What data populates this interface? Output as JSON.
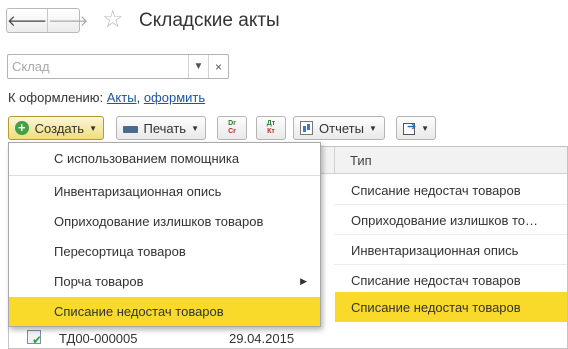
{
  "header": {
    "back_icon": "arrow-left-icon",
    "forward_icon": "arrow-right-icon",
    "back_glyph": "🡐",
    "forward_glyph": "🡒",
    "favorite_icon": "star-icon",
    "title": "Складские акты"
  },
  "filter": {
    "warehouse_placeholder": "Склад",
    "warehouse_value": ""
  },
  "info_line": {
    "prefix": "К оформлению:",
    "link_acts": "Акты",
    "separator": ",",
    "link_process": "оформить"
  },
  "toolbar": {
    "create_label": "Создать",
    "print_label": "Печать",
    "drcr_label_top": "Dr",
    "drcr_label_bottom": "Cr",
    "dtkt_label_top": "Дт",
    "dtkt_label_bottom": "Кт",
    "reports_label": "Отчеты"
  },
  "create_menu": {
    "items": [
      {
        "label": "С использованием помощника"
      },
      {
        "label": "Инвентаризационная опись"
      },
      {
        "label": "Оприходование излишков товаров"
      },
      {
        "label": "Пересортица товаров"
      },
      {
        "label": "Порча товаров",
        "has_submenu": true
      },
      {
        "label": "Списание недостач товаров",
        "highlighted": true
      }
    ]
  },
  "table": {
    "columns": {
      "type": "Тип"
    },
    "rows": [
      {
        "type": "Списание недостач товаров"
      },
      {
        "type": "Оприходование излишков товаров"
      },
      {
        "type": "Инвентаризационная опись"
      },
      {
        "type": "Списание недостач товаров"
      },
      {
        "type": "Списание недостач товаров",
        "selected": true
      },
      {
        "number": "ТД00-000005",
        "date": "29.04.2015",
        "type": ""
      }
    ]
  },
  "colors": {
    "highlight": "#f9d92a",
    "link": "#1a56a8",
    "create_button": "#f0dd7a",
    "posted_check": "#2e9d3a"
  }
}
